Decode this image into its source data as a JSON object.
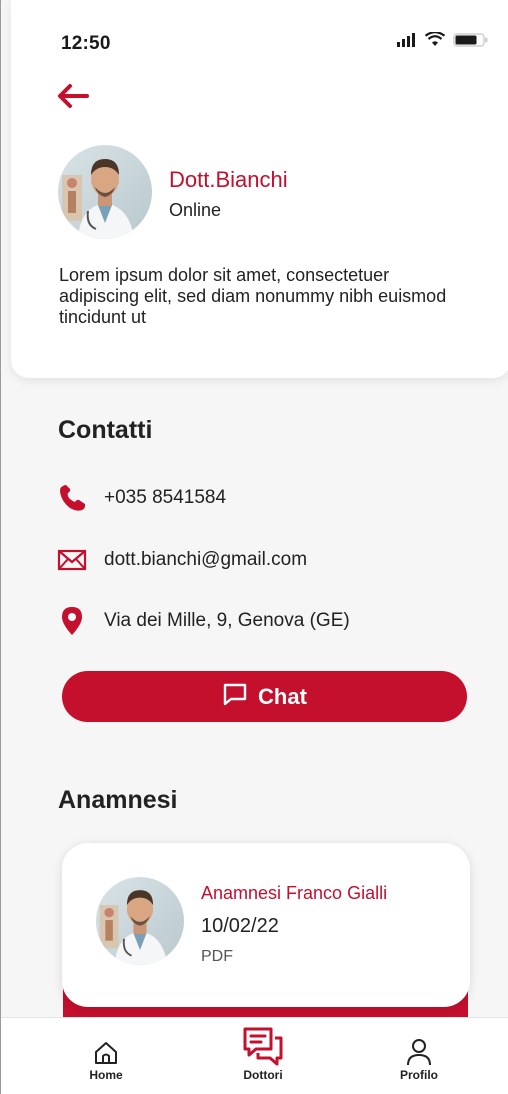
{
  "status_bar": {
    "time": "12:50",
    "icons": [
      "signal-icon",
      "wifi-icon",
      "battery-icon"
    ]
  },
  "header": {
    "back_icon": "arrow-left-icon",
    "doctor_name": "Dott.Bianchi",
    "doctor_status": "Online",
    "bio": "Lorem ipsum dolor sit amet, consectetuer adipiscing elit, sed diam nonummy nibh euismod tincidunt ut"
  },
  "contacts": {
    "title": "Contatti",
    "items": [
      {
        "icon": "phone-icon",
        "value": "+035 8541584"
      },
      {
        "icon": "mail-icon",
        "value": "dott.bianchi@gmail.com"
      },
      {
        "icon": "location-pin-icon",
        "value": "Via dei Mille, 9, Genova (GE)"
      }
    ],
    "chat_button": {
      "icon": "chat-bubble-icon",
      "label": "Chat"
    }
  },
  "anamnesi": {
    "title": "Anamnesi",
    "cards": [
      {
        "title": "Anamnesi Franco Gialli",
        "date": "10/02/22",
        "type": "PDF"
      }
    ]
  },
  "bottom_nav": {
    "items": [
      {
        "icon": "home-icon",
        "label": "Home",
        "active": false
      },
      {
        "icon": "chat-doctors-icon",
        "label": "Dottori",
        "active": true
      },
      {
        "icon": "user-icon",
        "label": "Profilo",
        "active": false
      }
    ]
  },
  "colors": {
    "accent": "#c40f2d",
    "text": "#222222",
    "background": "#f6f6f6",
    "card": "#ffffff"
  }
}
